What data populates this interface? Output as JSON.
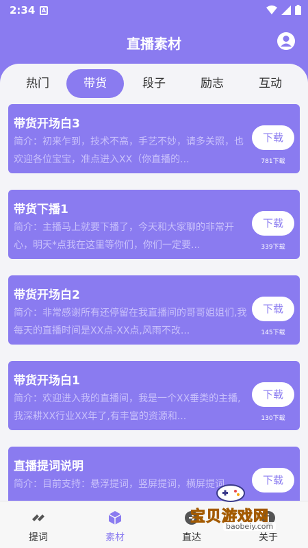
{
  "status": {
    "time": "2:34"
  },
  "header": {
    "title": "直播素材"
  },
  "tabs": [
    {
      "label": "热门",
      "active": false
    },
    {
      "label": "带货",
      "active": true
    },
    {
      "label": "段子",
      "active": false
    },
    {
      "label": "励志",
      "active": false
    },
    {
      "label": "互动",
      "active": false
    }
  ],
  "cards": [
    {
      "title": "带货开场白3",
      "desc": "简介：初来乍到，技术不高，手艺不妙，请多关照，也欢迎各位宝宝，准点进入XX（你直播的...",
      "button": "下载",
      "count": "781下载"
    },
    {
      "title": "带货下播1",
      "desc": "简介：主播马上就要下播了，今天和大家聊的非常开心，明天*点我在这里等你们，你们一定要...",
      "button": "下载",
      "count": "339下载"
    },
    {
      "title": "带货开场白2",
      "desc": "简介：非常感谢所有还停留在我直播间的哥哥姐姐们,我每天的直播时间是XX点-XX点,风雨不改...",
      "button": "下载",
      "count": "145下载"
    },
    {
      "title": "带货开场白1",
      "desc": "简介：欢迎进入我的直播间，我是一个XX垂类的主播,我深耕XX行业XX年了,有丰富的资源和...",
      "button": "下载",
      "count": "130下载"
    },
    {
      "title": "直播提词说明",
      "desc": "简介：目前支持：悬浮提词，竖屏提词，横屏提词...",
      "button": "下载",
      "count": ""
    }
  ],
  "bottom_nav": [
    {
      "label": "提词",
      "icon": "link-icon"
    },
    {
      "label": "素材",
      "icon": "cube-icon"
    },
    {
      "label": "直达",
      "icon": "arrow-icon"
    },
    {
      "label": "关于",
      "icon": "info-icon"
    }
  ],
  "watermark": {
    "text": "宝贝游戏网",
    "url": "baobeiy.com"
  },
  "colors": {
    "accent": "#8a7bf0",
    "panel": "#f4f4f8",
    "desc_text": "#c9c1fb"
  }
}
